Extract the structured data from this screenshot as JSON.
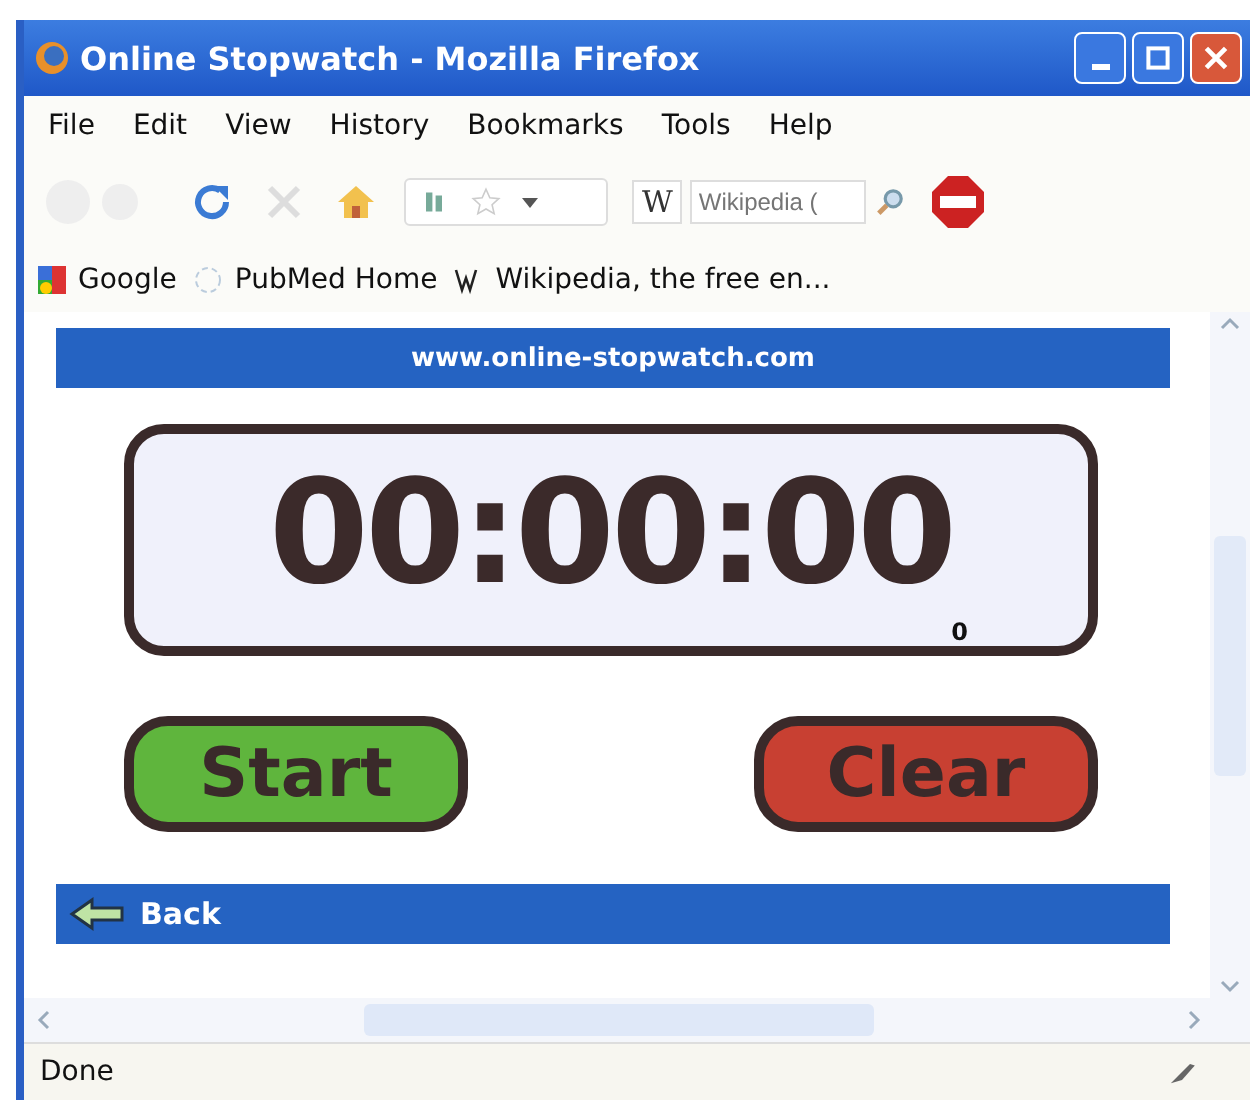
{
  "window": {
    "title": "Online Stopwatch - Mozilla Firefox"
  },
  "menu": [
    "File",
    "Edit",
    "View",
    "History",
    "Bookmarks",
    "Tools",
    "Help"
  ],
  "search": {
    "engine": "W",
    "placeholder": "Wikipedia ("
  },
  "bookmarks": [
    {
      "label": "Google",
      "kind": "google"
    },
    {
      "label": "PubMed Home",
      "kind": "page"
    },
    {
      "label": "Wikipedia, the free en...",
      "kind": "wiki"
    }
  ],
  "page": {
    "site": "www.online-stopwatch.com",
    "time": "00:00:00",
    "tenths": "0",
    "start": "Start",
    "clear": "Clear",
    "back": "Back"
  },
  "status_bar": "Done"
}
